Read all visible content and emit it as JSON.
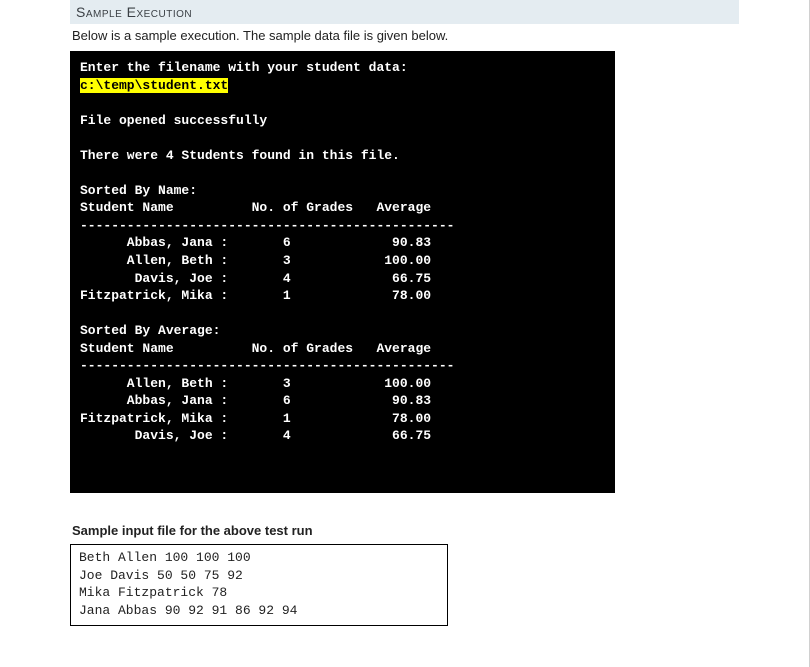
{
  "heading": "Sample Execution",
  "intro": "Below is a sample execution.  The sample data file is given below.",
  "console": {
    "prompt": "Enter the filename with your student data:",
    "user_input": "c:\\temp\\student.txt",
    "opened_msg": "File opened successfully",
    "count_msg": "There were 4 Students found in this file.",
    "sort1_title": "Sorted By Name:",
    "col_name": "Student Name",
    "col_grades": "No. of Grades",
    "col_avg": "Average",
    "rule": "------------------------------------------------",
    "by_name": [
      {
        "name": "Abbas, Jana",
        "grades": "6",
        "avg": "90.83"
      },
      {
        "name": "Allen, Beth",
        "grades": "3",
        "avg": "100.00"
      },
      {
        "name": "Davis, Joe",
        "grades": "4",
        "avg": "66.75"
      },
      {
        "name": "Fitzpatrick, Mika",
        "grades": "1",
        "avg": "78.00"
      }
    ],
    "sort2_title": "Sorted By Average:",
    "by_avg": [
      {
        "name": "Allen, Beth",
        "grades": "3",
        "avg": "100.00"
      },
      {
        "name": "Abbas, Jana",
        "grades": "6",
        "avg": "90.83"
      },
      {
        "name": "Fitzpatrick, Mika",
        "grades": "1",
        "avg": "78.00"
      },
      {
        "name": "Davis, Joe",
        "grades": "4",
        "avg": "66.75"
      }
    ]
  },
  "sample_file_heading": "Sample input file for the above test run",
  "sample_file_lines": [
    "Beth Allen 100 100 100",
    "Joe Davis 50 50 75 92",
    "Mika Fitzpatrick 78",
    "Jana Abbas 90 92 91 86 92 94"
  ]
}
